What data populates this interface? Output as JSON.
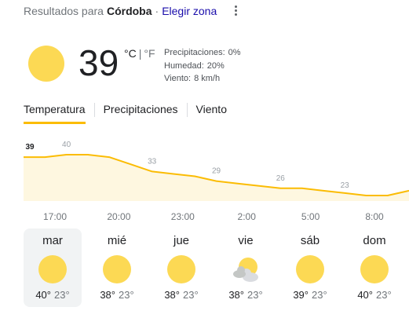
{
  "header": {
    "prefix": "Resultados para",
    "location": "Córdoba",
    "separator": "·",
    "change_location": "Elegir zona"
  },
  "current": {
    "temperature": "39",
    "unit_c": "°C",
    "unit_divider": "|",
    "unit_f": "°F",
    "icon": "sunny-icon",
    "precipitation_label": "Precipitaciones:",
    "precipitation_value": "0%",
    "humidity_label": "Humedad:",
    "humidity_value": "20%",
    "wind_label": "Viento:",
    "wind_value": "8 km/h"
  },
  "tabs": [
    {
      "label": "Temperatura",
      "active": true
    },
    {
      "label": "Precipitaciones",
      "active": false
    },
    {
      "label": "Viento",
      "active": false
    }
  ],
  "chart_data": {
    "type": "area",
    "series": [
      {
        "values": [
          39,
          39,
          40,
          40,
          39,
          36,
          33,
          32,
          31,
          29,
          28,
          27,
          26,
          26,
          25,
          24,
          23,
          23,
          25
        ]
      }
    ],
    "value_labels": [
      {
        "index": 0,
        "value": 39
      },
      {
        "index": 2,
        "value": 40
      },
      {
        "index": 6,
        "value": 33
      },
      {
        "index": 9,
        "value": 29
      },
      {
        "index": 12,
        "value": 26
      },
      {
        "index": 15,
        "value": 23
      }
    ],
    "x_labels": [
      "17:00",
      "20:00",
      "23:00",
      "2:00",
      "5:00",
      "8:00"
    ],
    "colors": {
      "line": "#fbbc04",
      "fill": "#fef7e0",
      "first_label": "#202124",
      "label": "#9aa0a6"
    }
  },
  "days": [
    {
      "name": "mar",
      "icon": "sunny-icon",
      "high": "40°",
      "low": "23°",
      "selected": true
    },
    {
      "name": "mié",
      "icon": "sunny-icon",
      "high": "38°",
      "low": "23°",
      "selected": false
    },
    {
      "name": "jue",
      "icon": "sunny-icon",
      "high": "38°",
      "low": "23°",
      "selected": false
    },
    {
      "name": "vie",
      "icon": "partly-cloudy-icon",
      "high": "38°",
      "low": "23°",
      "selected": false
    },
    {
      "name": "sáb",
      "icon": "sunny-icon",
      "high": "39°",
      "low": "23°",
      "selected": false
    },
    {
      "name": "dom",
      "icon": "sunny-icon",
      "high": "40°",
      "low": "23°",
      "selected": false
    }
  ]
}
